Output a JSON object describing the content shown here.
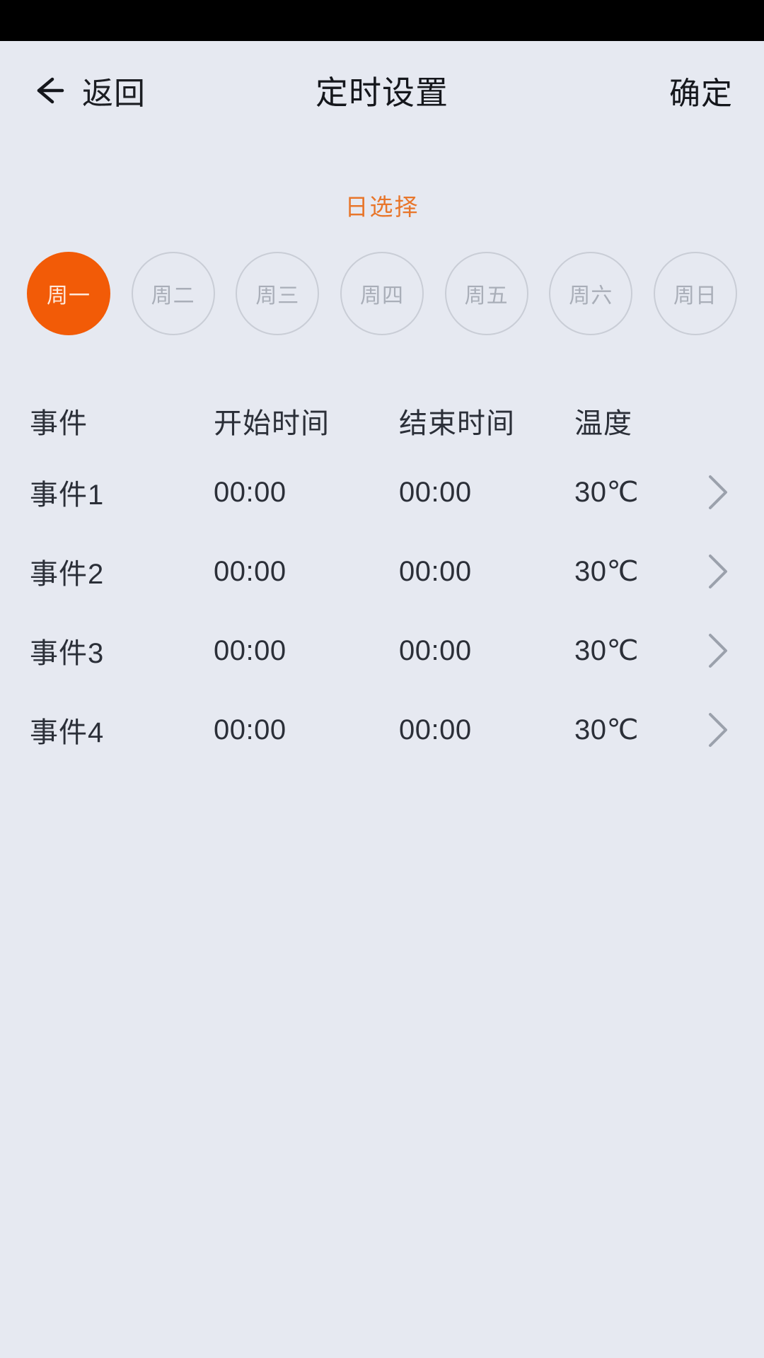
{
  "status_bar": {
    "background": "#000000"
  },
  "theme": {
    "background": "#e6e9f1",
    "accent": "#f25b07",
    "accent_text": "#e8762b",
    "text_primary": "#2b2f38",
    "text_muted": "#a9aeb8",
    "chip_border": "#c9cdd6"
  },
  "header": {
    "back_label": "返回",
    "back_icon": "arrow-left-icon",
    "title": "定时设置",
    "confirm_label": "确定"
  },
  "day_select": {
    "title": "日选择",
    "days": [
      {
        "label": "周一",
        "selected": true
      },
      {
        "label": "周二",
        "selected": false
      },
      {
        "label": "周三",
        "selected": false
      },
      {
        "label": "周四",
        "selected": false
      },
      {
        "label": "周五",
        "selected": false
      },
      {
        "label": "周六",
        "selected": false
      },
      {
        "label": "周日",
        "selected": false
      }
    ]
  },
  "table": {
    "columns": {
      "event": "事件",
      "start_time": "开始时间",
      "end_time": "结束时间",
      "temperature": "温度"
    },
    "arrow_icon": "chevron-right-icon",
    "rows": [
      {
        "event": "事件1",
        "start_time": "00:00",
        "end_time": "00:00",
        "temperature": "30℃"
      },
      {
        "event": "事件2",
        "start_time": "00:00",
        "end_time": "00:00",
        "temperature": "30℃"
      },
      {
        "event": "事件3",
        "start_time": "00:00",
        "end_time": "00:00",
        "temperature": "30℃"
      },
      {
        "event": "事件4",
        "start_time": "00:00",
        "end_time": "00:00",
        "temperature": "30℃"
      }
    ]
  }
}
